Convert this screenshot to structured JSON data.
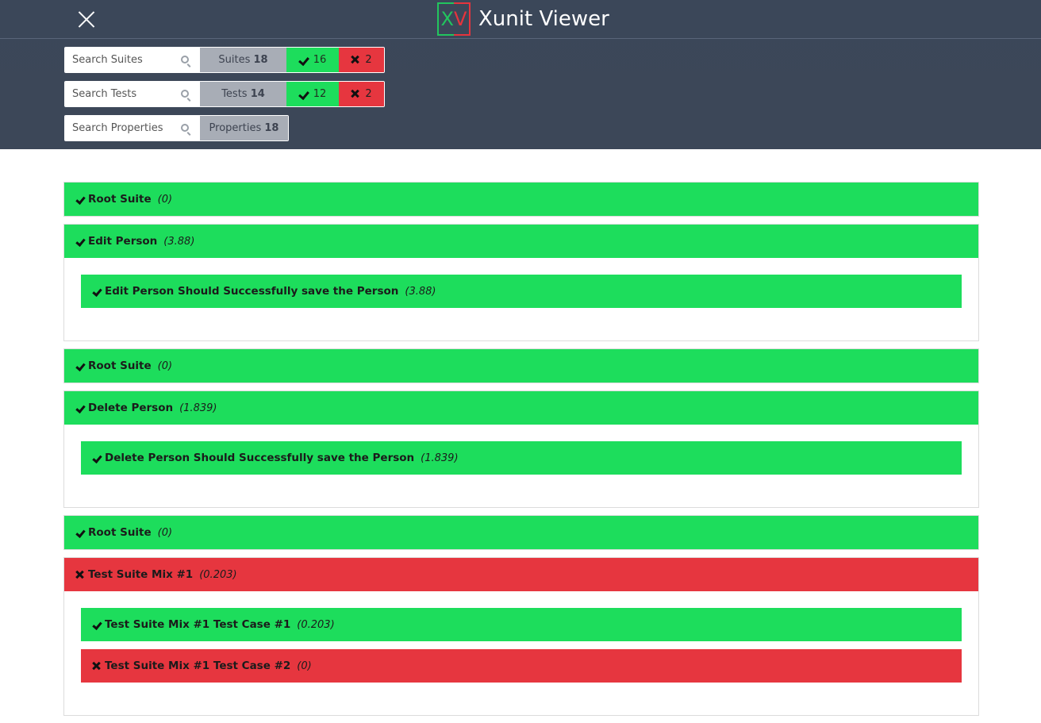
{
  "app": {
    "title": "Xunit Viewer",
    "logo_left": "X",
    "logo_right": "V"
  },
  "colors": {
    "header_bg": "#3c4758",
    "pass": "#1ddd5c",
    "fail": "#e6363f",
    "count_bg": "#a8adb6"
  },
  "filters": {
    "suites": {
      "placeholder": "Search Suites",
      "label": "Suites",
      "count": "18",
      "passed": "16",
      "failed": "2"
    },
    "tests": {
      "placeholder": "Search Tests",
      "label": "Tests",
      "count": "14",
      "passed": "12",
      "failed": "2"
    },
    "properties": {
      "placeholder": "Search Properties",
      "label": "Properties",
      "count": "18"
    }
  },
  "suites": [
    {
      "name": "Root Suite",
      "time": "(0)",
      "status": "pass",
      "tests": []
    },
    {
      "name": "Edit Person",
      "time": "(3.88)",
      "status": "pass",
      "tests": [
        {
          "name": "Edit Person Should Successfully save the Person",
          "time": "(3.88)",
          "status": "pass"
        }
      ]
    },
    {
      "name": "Root Suite",
      "time": "(0)",
      "status": "pass",
      "tests": []
    },
    {
      "name": "Delete Person",
      "time": "(1.839)",
      "status": "pass",
      "tests": [
        {
          "name": "Delete Person Should Successfully save the Person",
          "time": "(1.839)",
          "status": "pass"
        }
      ]
    },
    {
      "name": "Root Suite",
      "time": "(0)",
      "status": "pass",
      "tests": []
    },
    {
      "name": "Test Suite Mix #1",
      "time": "(0.203)",
      "status": "fail",
      "tests": [
        {
          "name": "Test Suite Mix #1 Test Case #1",
          "time": "(0.203)",
          "status": "pass"
        },
        {
          "name": "Test Suite Mix #1 Test Case #2",
          "time": "(0)",
          "status": "fail"
        }
      ]
    }
  ]
}
